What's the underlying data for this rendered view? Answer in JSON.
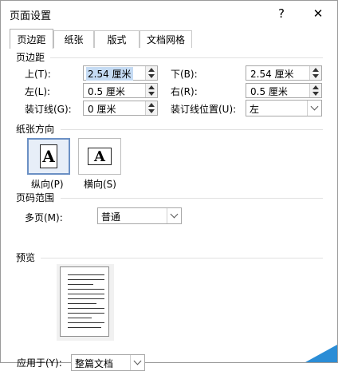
{
  "dialog": {
    "title": "页面设置",
    "help": "?",
    "close": "✕"
  },
  "tabs": [
    "页边距",
    "纸张",
    "版式",
    "文档网格"
  ],
  "margins": {
    "heading": "页边距",
    "top": {
      "label": "上(T):",
      "value": "2.54 厘米"
    },
    "bottom": {
      "label": "下(B):",
      "value": "2.54 厘米"
    },
    "left": {
      "label": "左(L):",
      "value": "0.5 厘米"
    },
    "right": {
      "label": "右(R):",
      "value": "0.5 厘米"
    },
    "gutter": {
      "label": "装订线(G):",
      "value": "0 厘米"
    },
    "gutter_position": {
      "label": "装订线位置(U):",
      "value": "左"
    }
  },
  "orientation": {
    "heading": "纸张方向",
    "portrait": {
      "label": "纵向(P)",
      "glyph": "A"
    },
    "landscape": {
      "label": "横向(S)",
      "glyph": "A"
    }
  },
  "pages": {
    "heading": "页码范围",
    "multiple_label": "多页(M):",
    "multiple_value": "普通"
  },
  "preview": {
    "heading": "预览"
  },
  "apply": {
    "label": "应用于(Y):",
    "value": "整篇文档"
  }
}
